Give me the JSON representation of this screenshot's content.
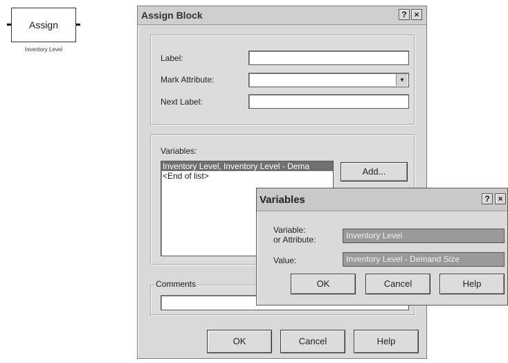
{
  "canvas": {
    "block_label": "Assign",
    "block_caption": "Inventory Level"
  },
  "dialog": {
    "title": "Assign Block",
    "help_glyph": "?",
    "close_glyph": "×",
    "label_label": "Label:",
    "label_value": "",
    "mark_attribute_label": "Mark Attribute:",
    "mark_attribute_value": "",
    "next_label_label": "Next Label:",
    "next_label_value": "",
    "variables_label": "Variables:",
    "variables_items": [
      "Inventory Level, Inventory Level - Dema",
      "<End of list>"
    ],
    "add_button": "Add...",
    "comments_label": "Comments",
    "comments_value": "",
    "ok": "OK",
    "cancel": "Cancel",
    "help": "Help"
  },
  "variables_dialog": {
    "title": "Variables",
    "help_glyph": "?",
    "close_glyph": "×",
    "variable_label_1": "Variable:",
    "variable_label_2": "or Attribute:",
    "variable_value": "Inventory Level",
    "value_label": "Value:",
    "value_value": "Inventory Level - Demand Size",
    "ok": "OK",
    "cancel": "Cancel",
    "help": "Help"
  }
}
